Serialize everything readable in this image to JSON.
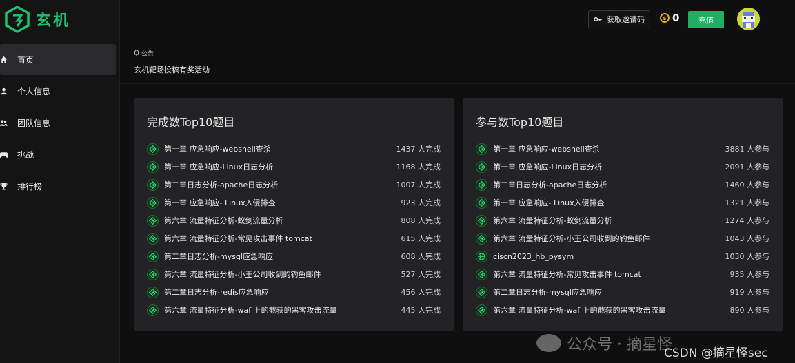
{
  "app": {
    "name": "玄机"
  },
  "sidebar": {
    "items": [
      {
        "label": "首页",
        "icon": "home-icon",
        "active": true
      },
      {
        "label": "个人信息",
        "icon": "user-icon",
        "active": false
      },
      {
        "label": "团队信息",
        "icon": "team-icon",
        "active": false
      },
      {
        "label": "挑战",
        "icon": "gamepad-icon",
        "active": false
      },
      {
        "label": "排行榜",
        "icon": "trophy-icon",
        "active": false
      }
    ]
  },
  "topbar": {
    "invite_label": "获取邀请码",
    "coins": "0",
    "recharge_label": "充值"
  },
  "notice": {
    "heading": "公告",
    "text": "玄机靶场投稿有奖活动"
  },
  "panels": {
    "completed": {
      "title": "完成数Top10题目",
      "rows": [
        {
          "name": "第一章 应急响应-webshell查杀",
          "count": "1437 人完成"
        },
        {
          "name": "第一章 应急响应-Linux日志分析",
          "count": "1168 人完成"
        },
        {
          "name": "第二章日志分析-apache日志分析",
          "count": "1007 人完成"
        },
        {
          "name": "第一章 应急响应- Linux入侵排查",
          "count": "923 人完成"
        },
        {
          "name": "第六章 流量特征分析-蚁剑流量分析",
          "count": "808 人完成"
        },
        {
          "name": "第六章 流量特征分析-常见攻击事件 tomcat",
          "count": "615 人完成"
        },
        {
          "name": "第二章日志分析-mysql应急响应",
          "count": "608 人完成"
        },
        {
          "name": "第六章 流量特征分析-小王公司收到的钓鱼邮件",
          "count": "527 人完成"
        },
        {
          "name": "第二章日志分析-redis应急响应",
          "count": "456 人完成"
        },
        {
          "name": "第六章 流量特征分析-waf 上的截获的黑客攻击流量",
          "count": "445 人完成"
        }
      ]
    },
    "participated": {
      "title": "参与数Top10题目",
      "rows": [
        {
          "name": "第一章 应急响应-webshell查杀",
          "count": "3881 人参与",
          "icon": "challenge-icon"
        },
        {
          "name": "第一章 应急响应-Linux日志分析",
          "count": "2091 人参与",
          "icon": "challenge-icon"
        },
        {
          "name": "第二章日志分析-apache日志分析",
          "count": "1460 人参与",
          "icon": "challenge-icon"
        },
        {
          "name": "第一章 应急响应- Linux入侵排查",
          "count": "1321 人参与",
          "icon": "challenge-icon"
        },
        {
          "name": "第六章 流量特征分析-蚁剑流量分析",
          "count": "1274 人参与",
          "icon": "challenge-icon"
        },
        {
          "name": "第六章 流量特征分析-小王公司收到的钓鱼邮件",
          "count": "1043 人参与",
          "icon": "challenge-icon"
        },
        {
          "name": "ciscn2023_hb_pysym",
          "count": "1030 人参与",
          "icon": "globe-icon"
        },
        {
          "name": "第六章 流量特征分析-常见攻击事件 tomcat",
          "count": "935 人参与",
          "icon": "challenge-icon"
        },
        {
          "name": "第二章日志分析-mysql应急响应",
          "count": "919 人参与",
          "icon": "challenge-icon"
        },
        {
          "name": "第六章 流量特征分析-waf 上的截获的黑客攻击流量",
          "count": "890 人参与",
          "icon": "challenge-icon"
        }
      ]
    }
  },
  "watermark": {
    "text": "公众号 · 摘星怪"
  },
  "csdn": {
    "text": "CSDN @摘星怪sec"
  },
  "colors": {
    "accent": "#1fae62",
    "background": "#0f0f10",
    "panel": "#232325",
    "coin": "#e0a920"
  }
}
